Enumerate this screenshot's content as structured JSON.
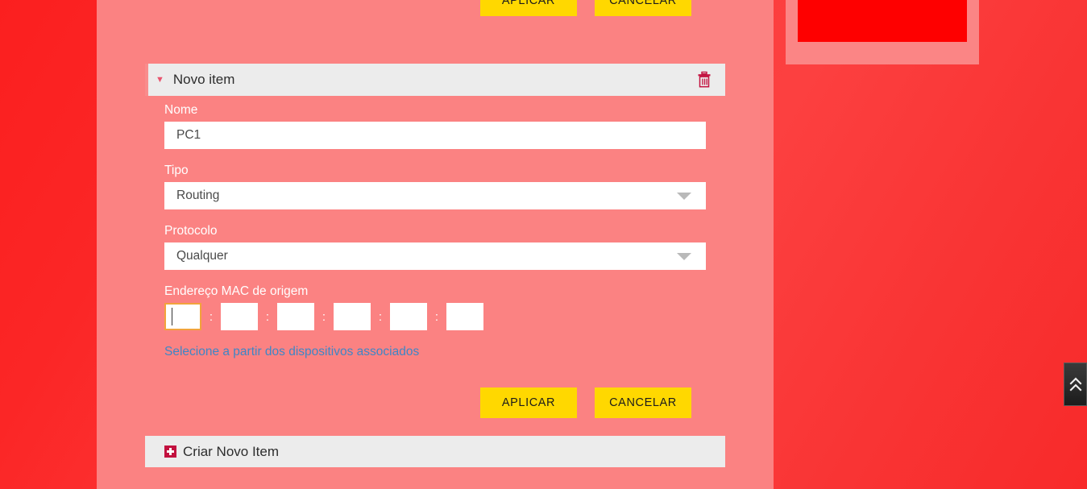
{
  "theme": {
    "background_red": "#fb2626",
    "panel_pink": "#fb8282",
    "button_yellow": "#ffd800",
    "accent_crimson": "#c2113f",
    "link_blue": "#3f86c6",
    "focus_orange": "#f2a33c",
    "header_grey": "#ececec"
  },
  "top_actions": {
    "apply_label": "APLICAR",
    "cancel_label": "CANCELAR"
  },
  "item_panel": {
    "caret": "▼",
    "title": "Novo item",
    "delete_icon": "trash-icon"
  },
  "form": {
    "name": {
      "label": "Nome",
      "value": "PC1",
      "placeholder": ""
    },
    "type": {
      "label": "Tipo",
      "value": "Routing",
      "options": [
        "Routing"
      ]
    },
    "protocol": {
      "label": "Protocolo",
      "value": "Qualquer",
      "options": [
        "Qualquer"
      ]
    },
    "mac": {
      "label": "Endereço MAC de origem",
      "separator": ":",
      "octets": [
        "",
        "",
        "",
        "",
        "",
        ""
      ],
      "focused_index": 0
    },
    "assoc_link": "Selecione a partir dos dispositivos associados"
  },
  "bottom_actions": {
    "apply_label": "APLICAR",
    "cancel_label": "CANCELAR"
  },
  "create_bar": {
    "label": "Criar Novo Item",
    "icon": "plus-square-icon"
  },
  "scroll_top": {
    "icon": "double-chevron-up-icon",
    "glyph_top": "⌃",
    "glyph_bottom": "⌃"
  }
}
